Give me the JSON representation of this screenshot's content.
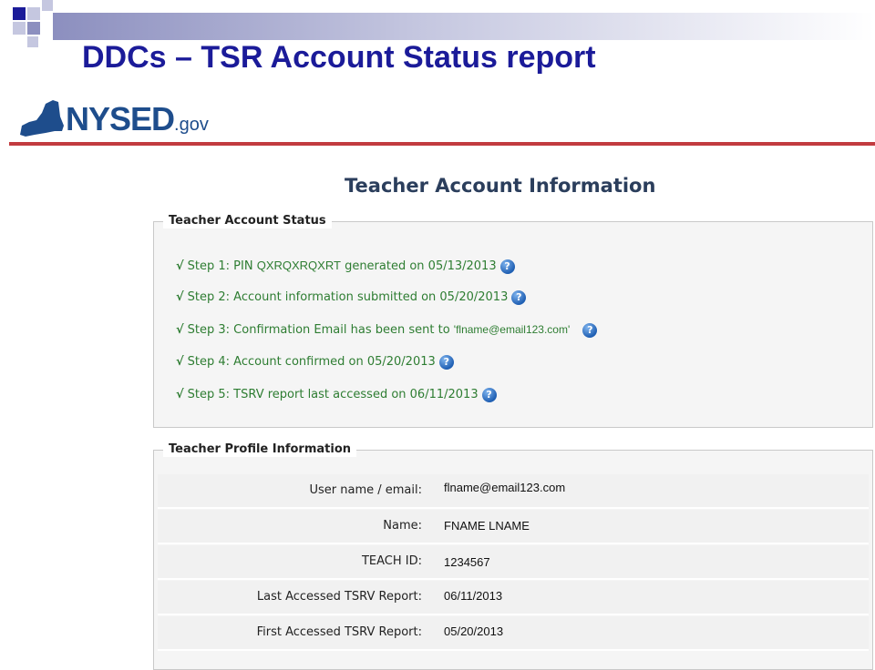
{
  "slide": {
    "title": "DDCs – TSR Account Status report"
  },
  "logo": {
    "main": "NYSED",
    "suffix": ".gov"
  },
  "page_heading": "Teacher Account Information",
  "status_section": {
    "legend": "Teacher Account Status",
    "steps": [
      {
        "prefix": "Step 1: PIN ",
        "value": "QXRQXRQXRT",
        "suffix": " generated on 05/13/2013"
      },
      {
        "text": "Step 2: Account information submitted on 05/20/2013"
      },
      {
        "text": "Step 3: Confirmation Email has been sent to ",
        "email": "'flname@email123.com'"
      },
      {
        "text": "Step 4: Account confirmed on 05/20/2013"
      },
      {
        "text": "Step 5: TSRV report last accessed on 06/11/2013"
      }
    ],
    "check_glyph": "√",
    "help_glyph": "?"
  },
  "profile_section": {
    "legend": "Teacher Profile Information",
    "rows": [
      {
        "label": "User name / email:",
        "value": "flname@email123.com"
      },
      {
        "label": "Name:",
        "value": "FNAME LNAME"
      },
      {
        "label": "TEACH ID:",
        "value": "1234567"
      },
      {
        "label": "Last Accessed TSRV Report:",
        "value": "06/11/2013"
      },
      {
        "label": "First Accessed TSRV Report:",
        "value": "05/20/2013"
      }
    ]
  },
  "colors": {
    "title": "#1b1b99",
    "accent_red": "#c23b3f",
    "step_green": "#2e7d32",
    "heading": "#2b3e5c"
  }
}
